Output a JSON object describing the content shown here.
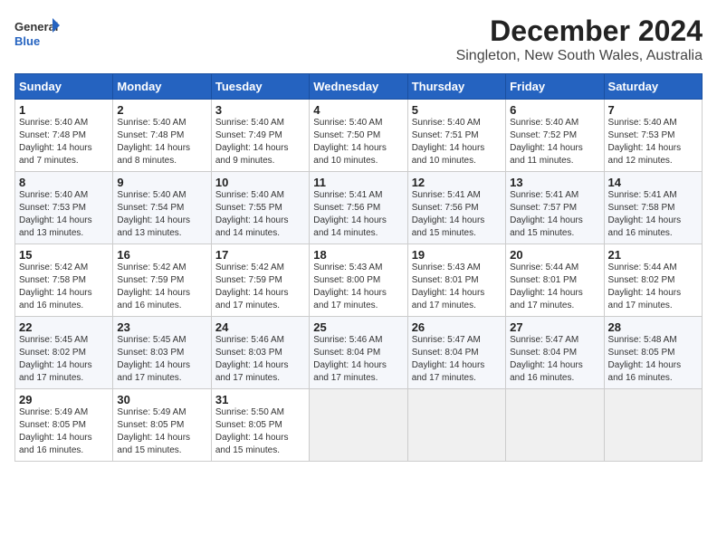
{
  "logo": {
    "line1": "General",
    "line2": "Blue"
  },
  "title": "December 2024",
  "subtitle": "Singleton, New South Wales, Australia",
  "days_header": [
    "Sunday",
    "Monday",
    "Tuesday",
    "Wednesday",
    "Thursday",
    "Friday",
    "Saturday"
  ],
  "weeks": [
    [
      {
        "day": "1",
        "info": "Sunrise: 5:40 AM\nSunset: 7:48 PM\nDaylight: 14 hours\nand 7 minutes."
      },
      {
        "day": "2",
        "info": "Sunrise: 5:40 AM\nSunset: 7:48 PM\nDaylight: 14 hours\nand 8 minutes."
      },
      {
        "day": "3",
        "info": "Sunrise: 5:40 AM\nSunset: 7:49 PM\nDaylight: 14 hours\nand 9 minutes."
      },
      {
        "day": "4",
        "info": "Sunrise: 5:40 AM\nSunset: 7:50 PM\nDaylight: 14 hours\nand 10 minutes."
      },
      {
        "day": "5",
        "info": "Sunrise: 5:40 AM\nSunset: 7:51 PM\nDaylight: 14 hours\nand 10 minutes."
      },
      {
        "day": "6",
        "info": "Sunrise: 5:40 AM\nSunset: 7:52 PM\nDaylight: 14 hours\nand 11 minutes."
      },
      {
        "day": "7",
        "info": "Sunrise: 5:40 AM\nSunset: 7:53 PM\nDaylight: 14 hours\nand 12 minutes."
      }
    ],
    [
      {
        "day": "8",
        "info": "Sunrise: 5:40 AM\nSunset: 7:53 PM\nDaylight: 14 hours\nand 13 minutes."
      },
      {
        "day": "9",
        "info": "Sunrise: 5:40 AM\nSunset: 7:54 PM\nDaylight: 14 hours\nand 13 minutes."
      },
      {
        "day": "10",
        "info": "Sunrise: 5:40 AM\nSunset: 7:55 PM\nDaylight: 14 hours\nand 14 minutes."
      },
      {
        "day": "11",
        "info": "Sunrise: 5:41 AM\nSunset: 7:56 PM\nDaylight: 14 hours\nand 14 minutes."
      },
      {
        "day": "12",
        "info": "Sunrise: 5:41 AM\nSunset: 7:56 PM\nDaylight: 14 hours\nand 15 minutes."
      },
      {
        "day": "13",
        "info": "Sunrise: 5:41 AM\nSunset: 7:57 PM\nDaylight: 14 hours\nand 15 minutes."
      },
      {
        "day": "14",
        "info": "Sunrise: 5:41 AM\nSunset: 7:58 PM\nDaylight: 14 hours\nand 16 minutes."
      }
    ],
    [
      {
        "day": "15",
        "info": "Sunrise: 5:42 AM\nSunset: 7:58 PM\nDaylight: 14 hours\nand 16 minutes."
      },
      {
        "day": "16",
        "info": "Sunrise: 5:42 AM\nSunset: 7:59 PM\nDaylight: 14 hours\nand 16 minutes."
      },
      {
        "day": "17",
        "info": "Sunrise: 5:42 AM\nSunset: 7:59 PM\nDaylight: 14 hours\nand 17 minutes."
      },
      {
        "day": "18",
        "info": "Sunrise: 5:43 AM\nSunset: 8:00 PM\nDaylight: 14 hours\nand 17 minutes."
      },
      {
        "day": "19",
        "info": "Sunrise: 5:43 AM\nSunset: 8:01 PM\nDaylight: 14 hours\nand 17 minutes."
      },
      {
        "day": "20",
        "info": "Sunrise: 5:44 AM\nSunset: 8:01 PM\nDaylight: 14 hours\nand 17 minutes."
      },
      {
        "day": "21",
        "info": "Sunrise: 5:44 AM\nSunset: 8:02 PM\nDaylight: 14 hours\nand 17 minutes."
      }
    ],
    [
      {
        "day": "22",
        "info": "Sunrise: 5:45 AM\nSunset: 8:02 PM\nDaylight: 14 hours\nand 17 minutes."
      },
      {
        "day": "23",
        "info": "Sunrise: 5:45 AM\nSunset: 8:03 PM\nDaylight: 14 hours\nand 17 minutes."
      },
      {
        "day": "24",
        "info": "Sunrise: 5:46 AM\nSunset: 8:03 PM\nDaylight: 14 hours\nand 17 minutes."
      },
      {
        "day": "25",
        "info": "Sunrise: 5:46 AM\nSunset: 8:04 PM\nDaylight: 14 hours\nand 17 minutes."
      },
      {
        "day": "26",
        "info": "Sunrise: 5:47 AM\nSunset: 8:04 PM\nDaylight: 14 hours\nand 17 minutes."
      },
      {
        "day": "27",
        "info": "Sunrise: 5:47 AM\nSunset: 8:04 PM\nDaylight: 14 hours\nand 16 minutes."
      },
      {
        "day": "28",
        "info": "Sunrise: 5:48 AM\nSunset: 8:05 PM\nDaylight: 14 hours\nand 16 minutes."
      }
    ],
    [
      {
        "day": "29",
        "info": "Sunrise: 5:49 AM\nSunset: 8:05 PM\nDaylight: 14 hours\nand 16 minutes."
      },
      {
        "day": "30",
        "info": "Sunrise: 5:49 AM\nSunset: 8:05 PM\nDaylight: 14 hours\nand 15 minutes."
      },
      {
        "day": "31",
        "info": "Sunrise: 5:50 AM\nSunset: 8:05 PM\nDaylight: 14 hours\nand 15 minutes."
      },
      null,
      null,
      null,
      null
    ]
  ]
}
